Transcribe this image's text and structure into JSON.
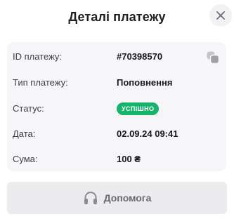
{
  "dialog": {
    "title": "Деталі платежу",
    "close_icon": "close-icon"
  },
  "details": {
    "rows": [
      {
        "label": "ID платежу:",
        "value": "#70398570",
        "action_icon": "copy-icon"
      },
      {
        "label": "Тип платежу:",
        "value": "Поповнення"
      },
      {
        "label": "Статус:",
        "badge": "УСПІШНО",
        "badge_color": "#16b36c"
      },
      {
        "label": "Дата:",
        "value": "02.09.24 09:41"
      },
      {
        "label": "Сума:",
        "value": "100 ₴"
      }
    ]
  },
  "help_button": {
    "label": "Допомога",
    "icon": "headphones-icon"
  },
  "colors": {
    "panel_background": "#f6f6f8",
    "button_background": "#ececee",
    "success": "#16b36c"
  }
}
